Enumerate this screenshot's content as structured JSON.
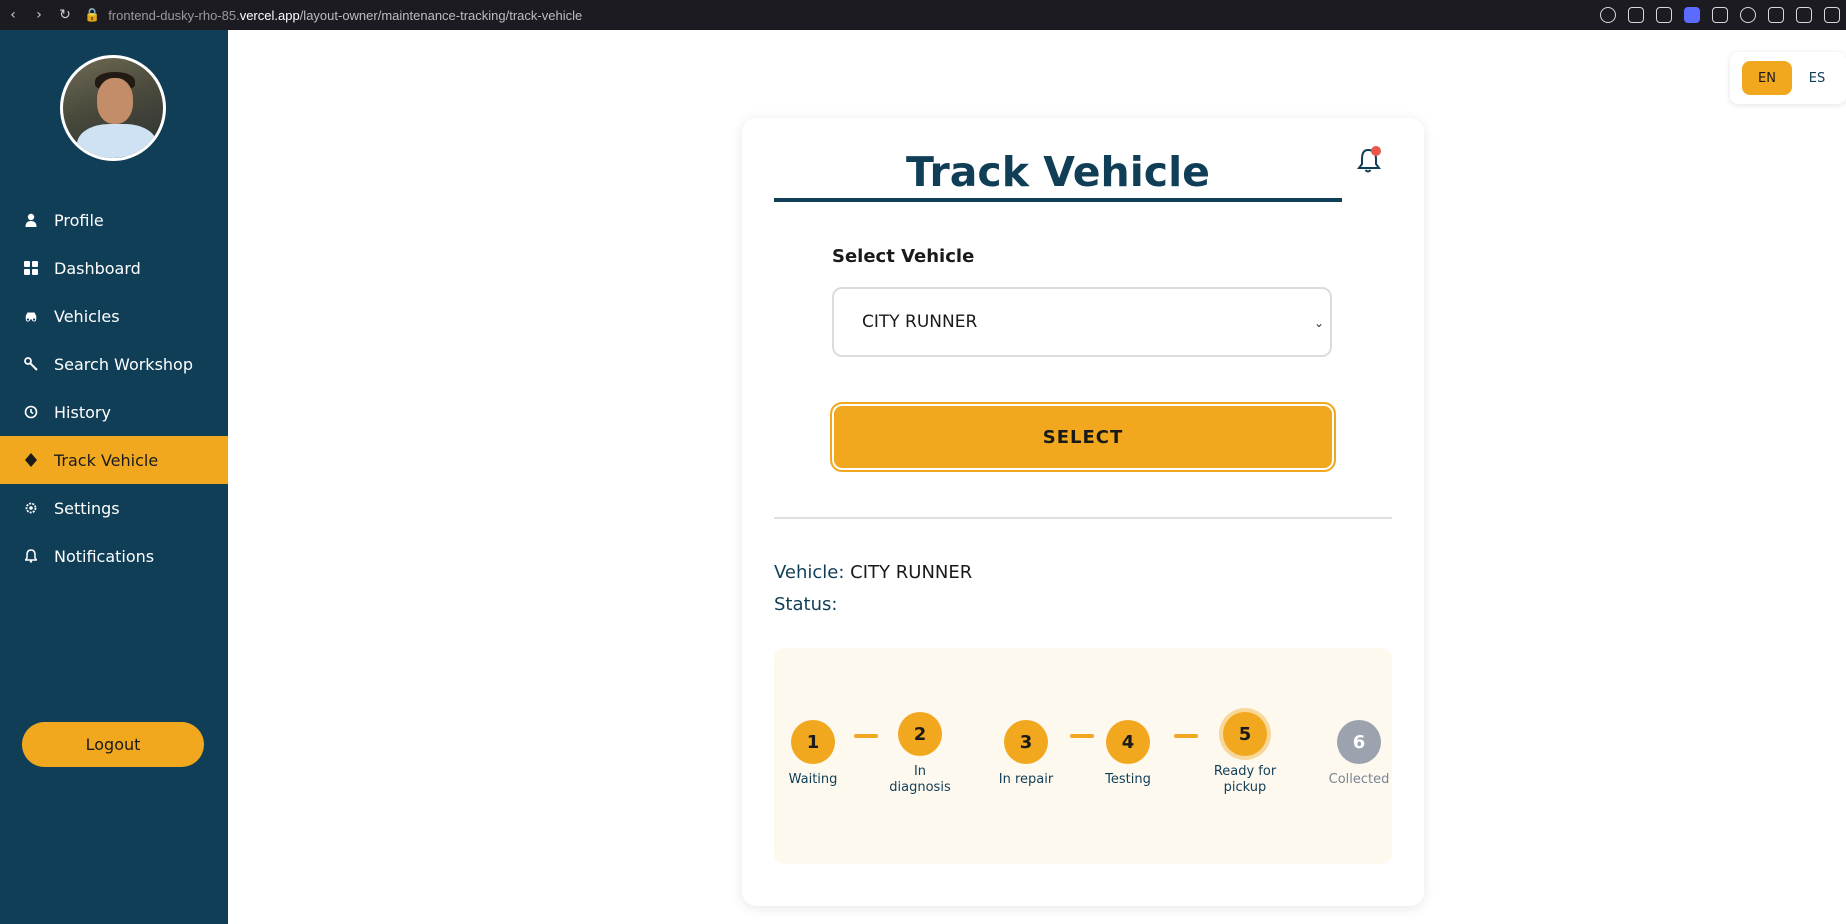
{
  "browser": {
    "url_host_prefix": "frontend-dusky-rho-85.",
    "url_host_bold": "vercel.app",
    "url_path": "/layout-owner/maintenance-tracking/track-vehicle"
  },
  "sidebar": {
    "items": [
      {
        "label": "Profile",
        "icon": "user-icon"
      },
      {
        "label": "Dashboard",
        "icon": "grid-icon"
      },
      {
        "label": "Vehicles",
        "icon": "car-icon"
      },
      {
        "label": "Search Workshop",
        "icon": "wrench-icon"
      },
      {
        "label": "History",
        "icon": "history-icon"
      },
      {
        "label": "Track Vehicle",
        "icon": "location-icon",
        "active": true
      },
      {
        "label": "Settings",
        "icon": "gear-icon"
      },
      {
        "label": "Notifications",
        "icon": "bell-icon"
      }
    ],
    "logout_label": "Logout"
  },
  "lang": {
    "en": "EN",
    "es": "ES",
    "active": "EN"
  },
  "card": {
    "title": "Track Vehicle",
    "select_label": "Select Vehicle",
    "select_value": "CITY RUNNER",
    "select_button": "SELECT",
    "vehicle_label": "Vehicle:",
    "vehicle_value": "CITY RUNNER",
    "status_label": "Status:",
    "status_value": ""
  },
  "tracker": {
    "steps": [
      {
        "num": "1",
        "label": "Waiting",
        "state": "done"
      },
      {
        "num": "2",
        "label": "In diagnosis",
        "state": "done"
      },
      {
        "num": "3",
        "label": "In repair",
        "state": "done"
      },
      {
        "num": "4",
        "label": "Testing",
        "state": "done"
      },
      {
        "num": "5",
        "label": "Ready for pickup",
        "state": "current"
      },
      {
        "num": "6",
        "label": "Collected",
        "state": "pending"
      }
    ]
  },
  "colors": {
    "sidebar_bg": "#113e57",
    "accent": "#f2a81e",
    "pending": "#9ca3ae",
    "notification_dot": "#e8584a"
  }
}
